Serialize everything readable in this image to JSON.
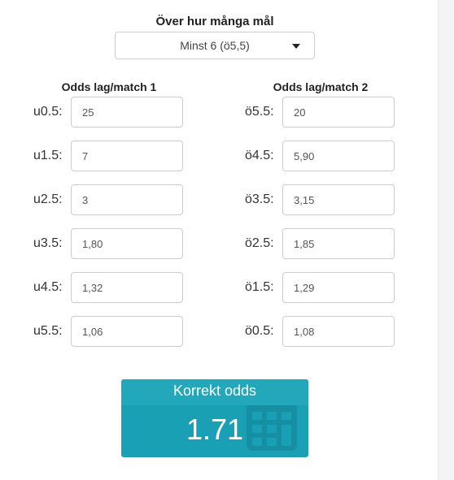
{
  "heading": "Över hur många mål",
  "select": {
    "value": "Minst 6 (ö5,5)"
  },
  "team1": {
    "header": "Odds lag/match 1",
    "rows": [
      {
        "label": "u0.5:",
        "value": "25"
      },
      {
        "label": "u1.5:",
        "value": "7"
      },
      {
        "label": "u2.5:",
        "value": "3"
      },
      {
        "label": "u3.5:",
        "value": "1,80"
      },
      {
        "label": "u4.5:",
        "value": "1,32"
      },
      {
        "label": "u5.5:",
        "value": "1,06"
      }
    ]
  },
  "team2": {
    "header": "Odds lag/match 2",
    "rows": [
      {
        "label": "ö5.5:",
        "value": "20"
      },
      {
        "label": "ö4.5:",
        "value": "5,90"
      },
      {
        "label": "ö3.5:",
        "value": "3,15"
      },
      {
        "label": "ö2.5:",
        "value": "1,85"
      },
      {
        "label": "ö1.5:",
        "value": "1,29"
      },
      {
        "label": "ö0.5:",
        "value": "1,08"
      }
    ]
  },
  "result": {
    "title": "Korrekt odds",
    "value": "1.71",
    "icon": "calculator-icon"
  },
  "colors": {
    "card": "#1aa0b5",
    "card_header": "#22a7bb"
  }
}
